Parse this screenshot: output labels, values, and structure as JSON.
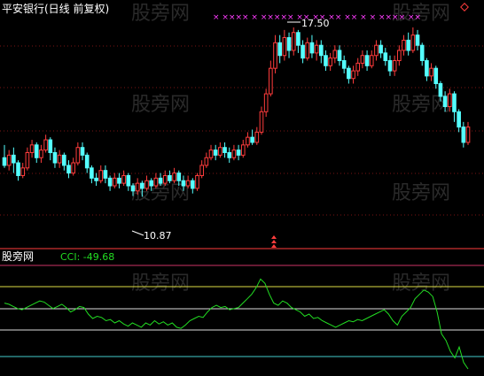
{
  "price_panel": {
    "title": "平安银行(日线 前复权)",
    "high_label": "17.50",
    "low_label": "10.87",
    "colors": {
      "up": "#ff3c3c",
      "down": "#54ffff",
      "grid": "#8b1a1a",
      "title": "#ffffff",
      "marker": "#ff3cff"
    }
  },
  "indicator_panel": {
    "name": "股旁网",
    "value_label": "CCI: -49.68",
    "colors": {
      "line": "#22dd22",
      "name": "#ffffff",
      "value": "#22dd22"
    }
  },
  "watermark": "股旁网",
  "chart_data": [
    {
      "type": "candlestick",
      "title": "平安银行(日线 前复权)",
      "annotations": [
        {
          "text": "17.50",
          "point": "high"
        },
        {
          "text": "10.87",
          "point": "low"
        }
      ],
      "ylim": [
        9.5,
        18.4
      ],
      "candles": [
        [
          12.4,
          12.1,
          12.9,
          12.0
        ],
        [
          12.1,
          12.5,
          12.7,
          11.9
        ],
        [
          12.5,
          12.2,
          12.8,
          11.8
        ],
        [
          12.2,
          11.7,
          12.3,
          11.5
        ],
        [
          11.7,
          12.0,
          12.2,
          11.6
        ],
        [
          12.0,
          12.6,
          12.8,
          11.9
        ],
        [
          12.6,
          12.9,
          13.1,
          12.4
        ],
        [
          12.9,
          12.4,
          13.0,
          12.2
        ],
        [
          12.4,
          12.7,
          12.9,
          12.2
        ],
        [
          12.7,
          13.1,
          13.3,
          12.6
        ],
        [
          13.1,
          12.6,
          13.2,
          12.3
        ],
        [
          12.6,
          12.2,
          12.8,
          12.0
        ],
        [
          12.2,
          12.5,
          12.7,
          12.0
        ],
        [
          12.5,
          12.1,
          12.6,
          11.9
        ],
        [
          12.1,
          11.8,
          12.3,
          11.6
        ],
        [
          11.8,
          12.2,
          12.4,
          11.7
        ],
        [
          12.2,
          12.8,
          13.0,
          12.1
        ],
        [
          12.8,
          12.5,
          13.0,
          12.3
        ],
        [
          12.5,
          12.0,
          12.6,
          11.8
        ],
        [
          12.0,
          11.6,
          12.1,
          11.4
        ],
        [
          11.6,
          11.5,
          11.8,
          11.3
        ],
        [
          11.5,
          11.9,
          12.1,
          11.4
        ],
        [
          11.9,
          11.6,
          12.1,
          11.4
        ],
        [
          11.6,
          11.3,
          11.7,
          11.1
        ],
        [
          11.3,
          11.6,
          11.8,
          11.2
        ],
        [
          11.6,
          11.4,
          11.8,
          11.2
        ],
        [
          11.4,
          11.7,
          11.9,
          11.3
        ],
        [
          11.7,
          11.3,
          11.8,
          11.1
        ],
        [
          11.3,
          11.1,
          11.4,
          10.9
        ],
        [
          11.1,
          11.4,
          11.6,
          10.95
        ],
        [
          11.4,
          11.2,
          11.5,
          10.87
        ],
        [
          11.2,
          11.5,
          11.7,
          11.1
        ],
        [
          11.5,
          11.3,
          11.6,
          11.1
        ],
        [
          11.3,
          11.6,
          11.8,
          11.2
        ],
        [
          11.6,
          11.4,
          11.8,
          11.3
        ],
        [
          11.4,
          11.7,
          11.9,
          11.3
        ],
        [
          11.7,
          11.5,
          11.9,
          11.4
        ],
        [
          11.5,
          11.8,
          12.0,
          11.4
        ],
        [
          11.8,
          11.5,
          11.9,
          11.3
        ],
        [
          11.5,
          11.3,
          11.7,
          11.1
        ],
        [
          11.3,
          11.5,
          11.7,
          11.2
        ],
        [
          11.5,
          11.2,
          11.6,
          11.0
        ],
        [
          11.2,
          11.7,
          11.8,
          11.1
        ],
        [
          11.7,
          12.1,
          12.3,
          11.6
        ],
        [
          12.1,
          12.4,
          12.6,
          12.0
        ],
        [
          12.4,
          12.7,
          12.9,
          12.3
        ],
        [
          12.7,
          12.5,
          12.9,
          12.3
        ],
        [
          12.5,
          12.8,
          13.0,
          12.4
        ],
        [
          12.8,
          12.6,
          13.0,
          12.4
        ],
        [
          12.6,
          12.4,
          12.8,
          12.2
        ],
        [
          12.4,
          12.7,
          12.9,
          12.3
        ],
        [
          12.7,
          12.5,
          12.9,
          12.3
        ],
        [
          12.5,
          12.9,
          13.1,
          12.4
        ],
        [
          12.9,
          13.2,
          13.4,
          12.8
        ],
        [
          13.2,
          13.0,
          13.5,
          12.9
        ],
        [
          13.0,
          13.4,
          13.6,
          12.9
        ],
        [
          13.4,
          14.2,
          14.4,
          13.3
        ],
        [
          14.2,
          14.9,
          15.1,
          14.0
        ],
        [
          14.9,
          15.9,
          16.2,
          14.8
        ],
        [
          15.9,
          16.9,
          17.2,
          15.7
        ],
        [
          16.9,
          16.4,
          17.2,
          16.1
        ],
        [
          16.4,
          17.1,
          17.4,
          16.2
        ],
        [
          17.1,
          16.6,
          17.3,
          16.3
        ],
        [
          16.6,
          17.3,
          17.5,
          16.4
        ],
        [
          17.3,
          16.8,
          17.4,
          16.5
        ],
        [
          16.8,
          16.3,
          17.0,
          16.1
        ],
        [
          16.3,
          16.9,
          17.1,
          16.2
        ],
        [
          16.9,
          16.5,
          17.2,
          16.3
        ],
        [
          16.5,
          16.8,
          17.0,
          16.2
        ],
        [
          16.8,
          16.4,
          17.0,
          16.1
        ],
        [
          16.4,
          16.0,
          16.6,
          15.8
        ],
        [
          16.0,
          16.3,
          16.5,
          15.8
        ],
        [
          16.3,
          16.6,
          16.8,
          16.1
        ],
        [
          16.6,
          16.2,
          16.8,
          16.0
        ],
        [
          16.2,
          15.9,
          16.4,
          15.7
        ],
        [
          15.9,
          15.5,
          16.0,
          15.3
        ],
        [
          15.5,
          15.8,
          16.0,
          15.3
        ],
        [
          15.8,
          16.1,
          16.3,
          15.6
        ],
        [
          16.1,
          16.4,
          16.6,
          15.9
        ],
        [
          16.4,
          16.0,
          16.6,
          15.8
        ],
        [
          16.0,
          16.4,
          16.6,
          15.9
        ],
        [
          16.4,
          16.8,
          17.0,
          16.2
        ],
        [
          16.8,
          16.5,
          17.0,
          16.3
        ],
        [
          16.5,
          16.2,
          16.7,
          16.0
        ],
        [
          16.2,
          15.8,
          16.4,
          15.6
        ],
        [
          15.8,
          16.2,
          16.4,
          15.6
        ],
        [
          16.2,
          16.6,
          16.8,
          16.0
        ],
        [
          16.6,
          17.0,
          17.2,
          16.4
        ],
        [
          17.0,
          16.6,
          17.3,
          16.4
        ],
        [
          16.6,
          17.2,
          17.5,
          16.5
        ],
        [
          17.2,
          16.8,
          17.4,
          16.6
        ],
        [
          16.8,
          16.2,
          16.9,
          16.0
        ],
        [
          16.2,
          15.6,
          16.3,
          15.4
        ],
        [
          15.6,
          15.9,
          16.1,
          15.4
        ],
        [
          15.9,
          15.3,
          16.0,
          15.1
        ],
        [
          15.3,
          14.8,
          15.4,
          14.6
        ],
        [
          14.8,
          14.4,
          15.0,
          14.2
        ],
        [
          14.4,
          14.9,
          15.1,
          14.2
        ],
        [
          14.9,
          14.2,
          15.0,
          13.8
        ],
        [
          14.2,
          13.6,
          14.3,
          13.4
        ],
        [
          13.6,
          13.0,
          13.8,
          12.8
        ],
        [
          13.0,
          13.6,
          13.8,
          12.9
        ]
      ]
    },
    {
      "type": "line",
      "series": [
        {
          "name": "CCI",
          "values": [
            20,
            15,
            5,
            -5,
            -10,
            0,
            10,
            20,
            30,
            25,
            10,
            -5,
            5,
            15,
            0,
            -20,
            -10,
            5,
            0,
            -30,
            -50,
            -40,
            -45,
            -60,
            -55,
            -70,
            -60,
            -75,
            -85,
            -70,
            -80,
            -90,
            -70,
            -80,
            -60,
            -75,
            -65,
            -80,
            -70,
            -90,
            -95,
            -80,
            -60,
            -50,
            -40,
            -45,
            -20,
            0,
            10,
            0,
            5,
            -10,
            -5,
            0,
            20,
            40,
            60,
            90,
            130,
            110,
            60,
            20,
            10,
            30,
            20,
            0,
            -10,
            -20,
            -40,
            -30,
            -50,
            -45,
            -60,
            -70,
            -80,
            -90,
            -80,
            -70,
            -60,
            -65,
            -55,
            -60,
            -50,
            -40,
            -30,
            -20,
            -10,
            -30,
            -60,
            -80,
            -40,
            -20,
            0,
            40,
            60,
            80,
            70,
            50,
            -20,
            -120,
            -150,
            -200,
            -230,
            -180,
            -250,
            -280
          ]
        }
      ],
      "ylim": [
        -300,
        200
      ]
    }
  ]
}
